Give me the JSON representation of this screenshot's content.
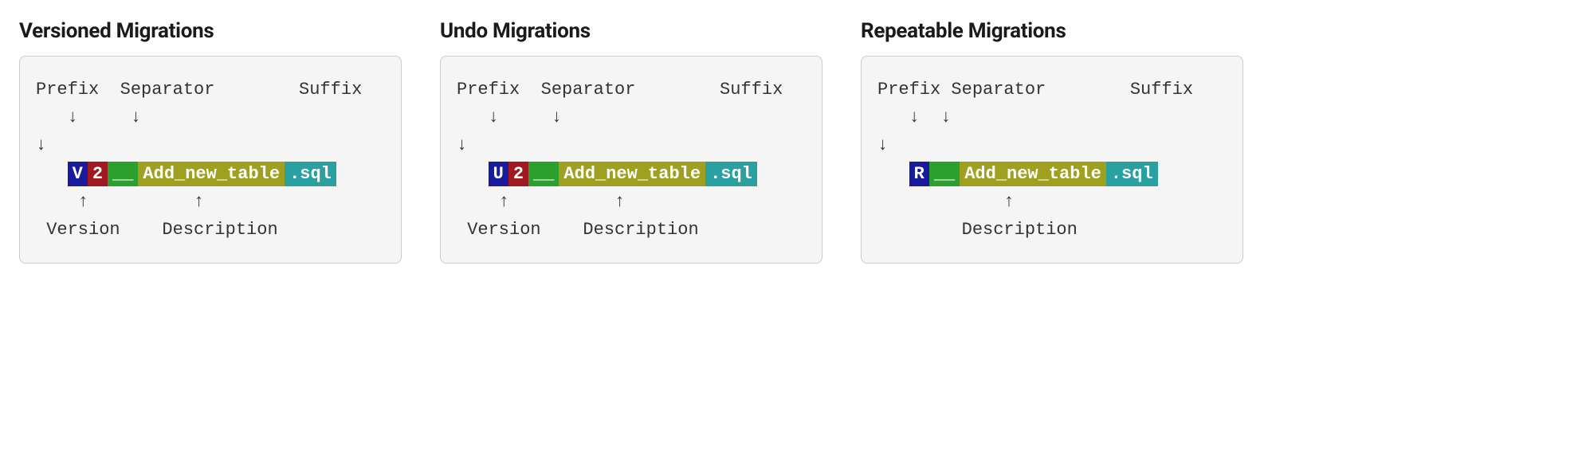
{
  "sections": [
    {
      "title": "Versioned Migrations",
      "top_labels": "Prefix  Separator        Suffix",
      "arrows_down_line1": "   ↓     ↓",
      "arrows_down_line2": "↓",
      "code": {
        "prefix": "V",
        "version": "2",
        "separator": "__",
        "description": "Add_new_table",
        "suffix": ".sql"
      },
      "arrows_up": "    ↑          ↑",
      "bottom_labels": " Version    Description"
    },
    {
      "title": "Undo Migrations",
      "top_labels": "Prefix  Separator        Suffix",
      "arrows_down_line1": "   ↓     ↓",
      "arrows_down_line2": "↓",
      "code": {
        "prefix": "U",
        "version": "2",
        "separator": "__",
        "description": "Add_new_table",
        "suffix": ".sql"
      },
      "arrows_up": "    ↑          ↑",
      "bottom_labels": " Version    Description"
    },
    {
      "title": "Repeatable Migrations",
      "top_labels": "Prefix Separator        Suffix",
      "arrows_down_line1": "   ↓  ↓",
      "arrows_down_line2": "↓",
      "code": {
        "prefix": "R",
        "version": "",
        "separator": "__",
        "description": "Add_new_table",
        "suffix": ".sql"
      },
      "arrows_up": "            ↑",
      "bottom_labels": "        Description"
    }
  ]
}
